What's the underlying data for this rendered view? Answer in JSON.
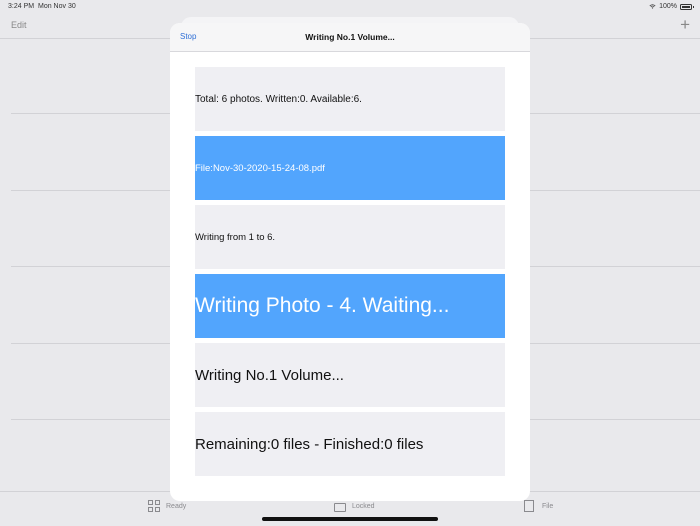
{
  "status": {
    "time": "3:24 PM",
    "date": "Mon Nov 30",
    "battery": "100%"
  },
  "nav": {
    "edit_label": "Edit",
    "add_label": "+"
  },
  "tabs": [
    {
      "label": "Ready",
      "icon": "grid-icon"
    },
    {
      "label": "Locked",
      "icon": "lock-icon"
    },
    {
      "label": "File",
      "icon": "file-icon"
    }
  ],
  "modal": {
    "stop_label": "Stop",
    "title": "Writing No.1 Volume...",
    "rows": [
      {
        "text": "Total: 6 photos. Written:0. Available:6."
      },
      {
        "text": "File:Nov-30-2020-15-24-08.pdf"
      },
      {
        "text": "Writing from 1 to 6."
      },
      {
        "text": "Writing Photo - 4. Waiting..."
      },
      {
        "text": "Writing No.1 Volume..."
      },
      {
        "text": "Remaining:0 files - Finished:0 files"
      }
    ]
  },
  "colors": {
    "accent": "#2f6fd6",
    "highlight_row": "#52a5fd",
    "row_gray": "#efeff3"
  }
}
